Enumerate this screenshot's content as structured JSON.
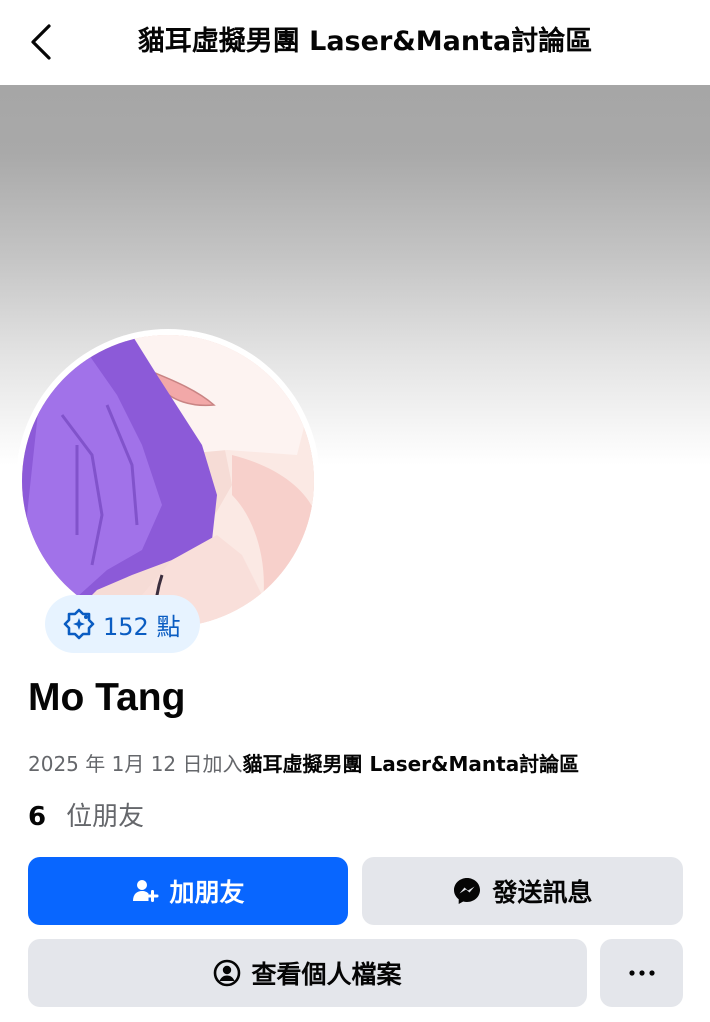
{
  "header": {
    "title": "貓耳虛擬男團 Laser&Manta討論區",
    "back_icon": "chevron-left-icon"
  },
  "colors": {
    "primary": "#0866ff",
    "secondary_button": "#e4e6eb",
    "badge_bg": "#e7f3ff",
    "badge_text": "#0a5cc2",
    "muted_text": "#65676b"
  },
  "profile": {
    "name": "Mo Tang",
    "points": {
      "icon": "star-badge-icon",
      "label": "152 點"
    },
    "joined_prefix": "2025 年 1月 12 日加入",
    "joined_group": "貓耳虛擬男團 Laser&Manta討論區",
    "friends_count": "6",
    "friends_label": "位朋友"
  },
  "actions": {
    "add_friend": {
      "label": "加朋友",
      "icon": "add-person-icon"
    },
    "message": {
      "label": "發送訊息",
      "icon": "messenger-icon"
    },
    "view_profile": {
      "label": "查看個人檔案",
      "icon": "user-circle-icon"
    },
    "more": {
      "label": "···",
      "icon": "more-dots-icon"
    }
  }
}
